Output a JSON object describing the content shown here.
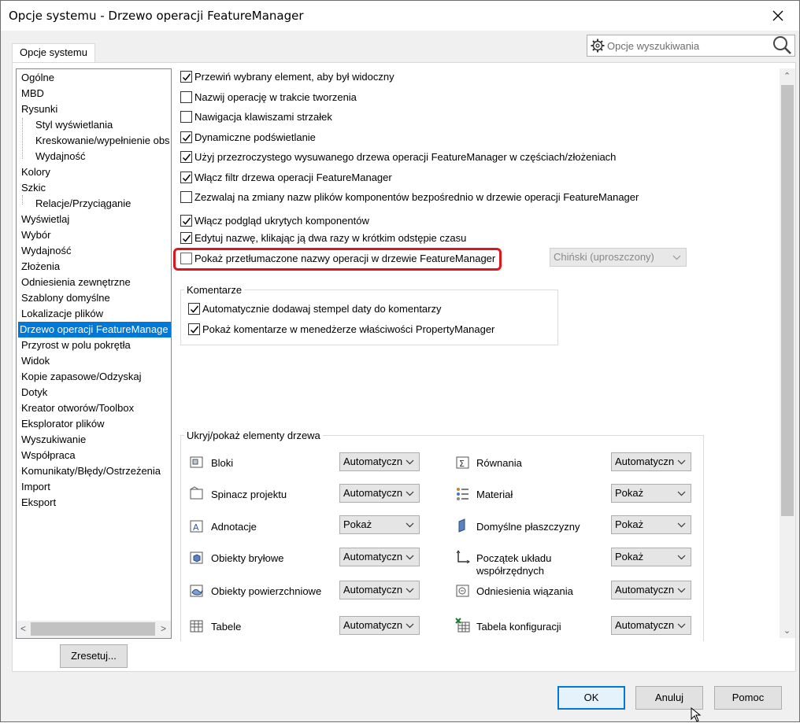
{
  "window": {
    "title": "Opcje systemu - Drzewo operacji FeatureManager"
  },
  "tab": {
    "label": "Opcje systemu"
  },
  "search": {
    "placeholder": "Opcje wyszukiwania"
  },
  "tree": {
    "items": [
      {
        "label": "Ogólne",
        "level": 0
      },
      {
        "label": "MBD",
        "level": 0
      },
      {
        "label": "Rysunki",
        "level": 0
      },
      {
        "label": "Styl wyświetlania",
        "level": 1
      },
      {
        "label": "Kreskowanie/wypełnienie obs",
        "level": 1
      },
      {
        "label": "Wydajność",
        "level": 1
      },
      {
        "label": "Kolory",
        "level": 0
      },
      {
        "label": "Szkic",
        "level": 0
      },
      {
        "label": "Relacje/Przyciąganie",
        "level": 1
      },
      {
        "label": "Wyświetlaj",
        "level": 0
      },
      {
        "label": "Wybór",
        "level": 0
      },
      {
        "label": "Wydajność",
        "level": 0
      },
      {
        "label": "Złożenia",
        "level": 0
      },
      {
        "label": "Odniesienia zewnętrzne",
        "level": 0
      },
      {
        "label": "Szablony domyślne",
        "level": 0
      },
      {
        "label": "Lokalizacje plików",
        "level": 0
      },
      {
        "label": "Drzewo operacji FeatureManage",
        "level": 0,
        "selected": true
      },
      {
        "label": "Przyrost w polu pokrętła",
        "level": 0
      },
      {
        "label": "Widok",
        "level": 0
      },
      {
        "label": "Kopie zapasowe/Odzyskaj",
        "level": 0
      },
      {
        "label": "Dotyk",
        "level": 0
      },
      {
        "label": "Kreator otworów/Toolbox",
        "level": 0
      },
      {
        "label": "Eksplorator plików",
        "level": 0
      },
      {
        "label": "Wyszukiwanie",
        "level": 0
      },
      {
        "label": "Współpraca",
        "level": 0
      },
      {
        "label": "Komunikaty/Błędy/Ostrzeżenia",
        "level": 0
      },
      {
        "label": "Import",
        "level": 0
      },
      {
        "label": "Eksport",
        "level": 0
      }
    ]
  },
  "reset_button": "Zresetuj...",
  "options": [
    {
      "label": "Przewiń wybrany element, aby był widoczny",
      "checked": true
    },
    {
      "label": "Nazwij operację w trakcie tworzenia",
      "checked": false
    },
    {
      "label": "Nawigacja klawiszami strzałek",
      "checked": false
    },
    {
      "label": "Dynamiczne podświetlanie",
      "checked": true
    },
    {
      "label": "Użyj przezroczystego wysuwanego drzewa operacji FeatureManager w częściach/złożeniach",
      "checked": true
    },
    {
      "label": "Włącz filtr drzewa operacji FeatureManager",
      "checked": true
    },
    {
      "label": "Zezwalaj na zmiany nazw plików komponentów bezpośrednio w drzewie operacji FeatureManager",
      "checked": false
    },
    {
      "label": "Włącz podgląd ukrytych komponentów",
      "checked": true
    },
    {
      "label": "Edytuj nazwę, klikając ją dwa razy w krótkim odstępie czasu",
      "checked": true
    },
    {
      "label": "Pokaż przetłumaczone nazwy operacji w drzewie FeatureManager",
      "checked": false
    }
  ],
  "language_select": {
    "value": "Chiński (uproszczony)"
  },
  "comments": {
    "title": "Komentarze",
    "items": [
      {
        "label": "Automatycznie dodawaj stempel daty do komentarzy",
        "checked": true
      },
      {
        "label": "Pokaż komentarze w menedżerze właściwości PropertyManager",
        "checked": true
      }
    ]
  },
  "tree_elements": {
    "title": "Ukryj/pokaż elementy drzewa",
    "left": [
      {
        "label": "Bloki",
        "icon": "blocks-icon",
        "value": "Automatyczn"
      },
      {
        "label": "Spinacz projektu",
        "icon": "design-binder-icon",
        "value": "Automatyczn"
      },
      {
        "label": "Adnotacje",
        "icon": "annotations-icon",
        "value": "Pokaż"
      },
      {
        "label": "Obiekty bryłowe",
        "icon": "solid-bodies-icon",
        "value": "Automatyczn"
      },
      {
        "label": "Obiekty powierzchniowe",
        "icon": "surface-bodies-icon",
        "value": "Automatyczn"
      },
      {
        "label": "Tabele",
        "icon": "tables-icon",
        "value": "Automatyczn"
      }
    ],
    "right": [
      {
        "label": "Równania",
        "icon": "equations-icon",
        "value": "Automatyczn"
      },
      {
        "label": "Materiał",
        "icon": "material-icon",
        "value": "Pokaż"
      },
      {
        "label": "Domyślne płaszczyzny",
        "icon": "default-planes-icon",
        "value": "Pokaż"
      },
      {
        "label": "Początek układu współrzędnych",
        "icon": "origin-icon",
        "value": "Pokaż"
      },
      {
        "label": "Odniesienia wiązania",
        "icon": "mate-references-icon",
        "value": "Automatyczn"
      },
      {
        "label": "Tabela konfiguracji",
        "icon": "design-table-icon",
        "value": "Automatyczn"
      }
    ]
  },
  "footer": {
    "ok": "OK",
    "cancel": "Anuluj",
    "help": "Pomoc"
  },
  "colors": {
    "selection": "#0078d7",
    "highlight_border": "#e0141b",
    "primary_button": "#0078d7"
  }
}
